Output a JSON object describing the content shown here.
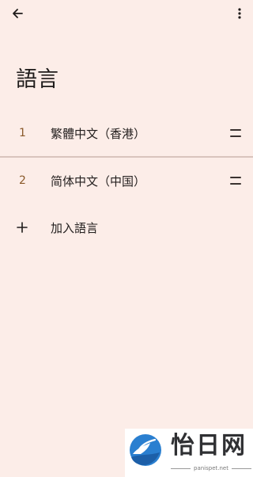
{
  "header": {
    "back_icon": "arrow-back-icon",
    "more_icon": "more-vert-icon"
  },
  "page": {
    "title": "語言"
  },
  "languages": [
    {
      "number": "1",
      "name": "繁體中文（香港）",
      "handle_icon": "drag-handle-icon"
    },
    {
      "number": "2",
      "name": "简体中文（中国）",
      "handle_icon": "drag-handle-icon"
    }
  ],
  "add_language": {
    "icon": "plus-icon",
    "label": "加入語言"
  },
  "watermark": {
    "text": "怡日网",
    "url": "panispet.net"
  },
  "colors": {
    "background": "#fcede8",
    "number_accent": "#8a5a2b",
    "divider": "#d9c4bd"
  }
}
